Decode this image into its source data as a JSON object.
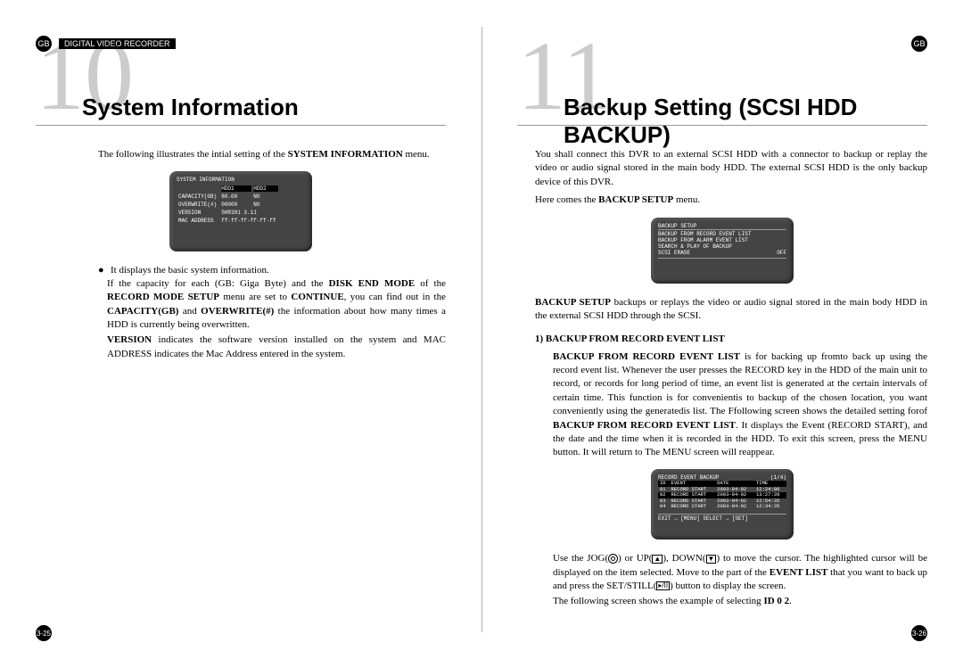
{
  "common": {
    "gb": "GB",
    "header_label": "DIGITAL VIDEO RECORDER"
  },
  "left": {
    "chapter": "10",
    "title": "System Information",
    "intro_pre": "The following illustrates the intial setting of the ",
    "intro_bold": "SYSTEM INFORMATION",
    "intro_post": " menu.",
    "screen": {
      "title": "SYSTEM INFORMATION",
      "hdr1": "HDD1",
      "hdr2": "HDD2",
      "rows": [
        {
          "l": "CAPACITY(GB)",
          "a": "80.00",
          "b": "NO"
        },
        {
          "l": "OVERWRITE(#)",
          "a": "00000",
          "b": "NO"
        },
        {
          "l": "VERSION",
          "a": "SHR301 3.11",
          "b": ""
        },
        {
          "l": "MAC ADDRESS",
          "a": "ff-ff-ff-ff-ff-ff",
          "b": ""
        }
      ]
    },
    "b1": "It displays the basic system information.",
    "p1_a": "If the capacity for each (GB: Giga Byte) and the ",
    "p1_b": "DISK END MODE",
    "p1_c": " of the ",
    "p1_d": "RECORD MODE SETUP",
    "p1_e": " menu are set to ",
    "p1_f": "CONTINUE",
    "p1_g": ", you can find out in the ",
    "p1_h": "CAPACITY(GB)",
    "p1_i": " and ",
    "p1_j": "OVERWRITE(#)",
    "p1_k": " the information about how many times a HDD is currently being overwritten.",
    "p2_a": "VERSION",
    "p2_b": " indicates the software version installed on the system and MAC ADDRESS indicates the Mac Address entered in the system.",
    "page_num": "3-25"
  },
  "right": {
    "chapter": "11",
    "title": "Backup Setting (SCSI HDD BACKUP)",
    "p1": "You shall connect this DVR to an external SCSI HDD with a connector to backup or replay the video or audio signal stored in the main body HDD. The external SCSI HDD is the only backup device of this DVR.",
    "p2_a": "Here comes the ",
    "p2_b": "BACKUP SETUP",
    "p2_c": " menu.",
    "screen1": {
      "title": "BACKUP SETUP",
      "lines": [
        "BACKUP FROM RECORD EVENT LIST",
        "BACKUP FROM ALARM EVENT LIST",
        "SEARCH & PLAY OF BACKUP"
      ],
      "last_l": "SCSI ERASE",
      "last_r": "OFF"
    },
    "p3_a": "BACKUP SETUP",
    "p3_b": " backups or replays the video or audio signal stored in the main body HDD in the external SCSI HDD through the SCSI.",
    "h1": "1) BACKUP FROM RECORD EVENT LIST",
    "p4_a": "BACKUP FROM RECORD EVENT LIST",
    "p4_b": " is for backing up fromto back up using the record event list. Whenever the user presses the RECORD key in the HDD of the main unit to record, or records for long period of time, an event list is generated at the certain intervals of certain time. This function is for convenientis to backup of the chosen location, you want conveniently using the generatedis list. The Ffollowing screen shows the detailed setting forof ",
    "p4_c": "BACKUP FROM RECORD EVENT LIST",
    "p4_d": ". It displays the Event (RECORD START), and the date and the time when it is recorded in the HDD. To exit this screen, press the MENU button. It will return to The MENU screen will reappear.",
    "screen2": {
      "title": "RECORD EVENT BACKUP",
      "pager": "(1/4)",
      "cols": [
        "ID",
        "EVENT",
        "DATE",
        "TIME"
      ],
      "rows": [
        {
          "id": "01",
          "ev": "RECORD START",
          "dt": "2003-04-02",
          "tm": "12:24:00",
          "sel": false
        },
        {
          "id": "02",
          "ev": "RECORD START",
          "dt": "2003-04-02",
          "tm": "13:27:39",
          "sel": true
        },
        {
          "id": "03",
          "ev": "RECORD START",
          "dt": "2003-04-02",
          "tm": "12:54:35",
          "sel": false
        },
        {
          "id": "04",
          "ev": "RECORD START",
          "dt": "2003-04-02",
          "tm": "12:34:35",
          "sel": false
        }
      ],
      "footer": "EXIT → [MENU]  SELECT → [SET]"
    },
    "p5_a": "Use the JOG(",
    "p5_b": ") or UP(",
    "p5_c": "), DOWN(",
    "p5_d": ") to move the cursor. The highlighted cursor will be displayed on the item selected. Move to the part of the ",
    "p5_e": "EVENT LIST",
    "p5_f": " that you want to back up and press the SET/STILL(",
    "p5_g": ") button to display the screen.",
    "p6_a": "The following screen shows the example of selecting ",
    "p6_b": "ID 0 2",
    "p6_c": ".",
    "page_num": "3-26"
  }
}
